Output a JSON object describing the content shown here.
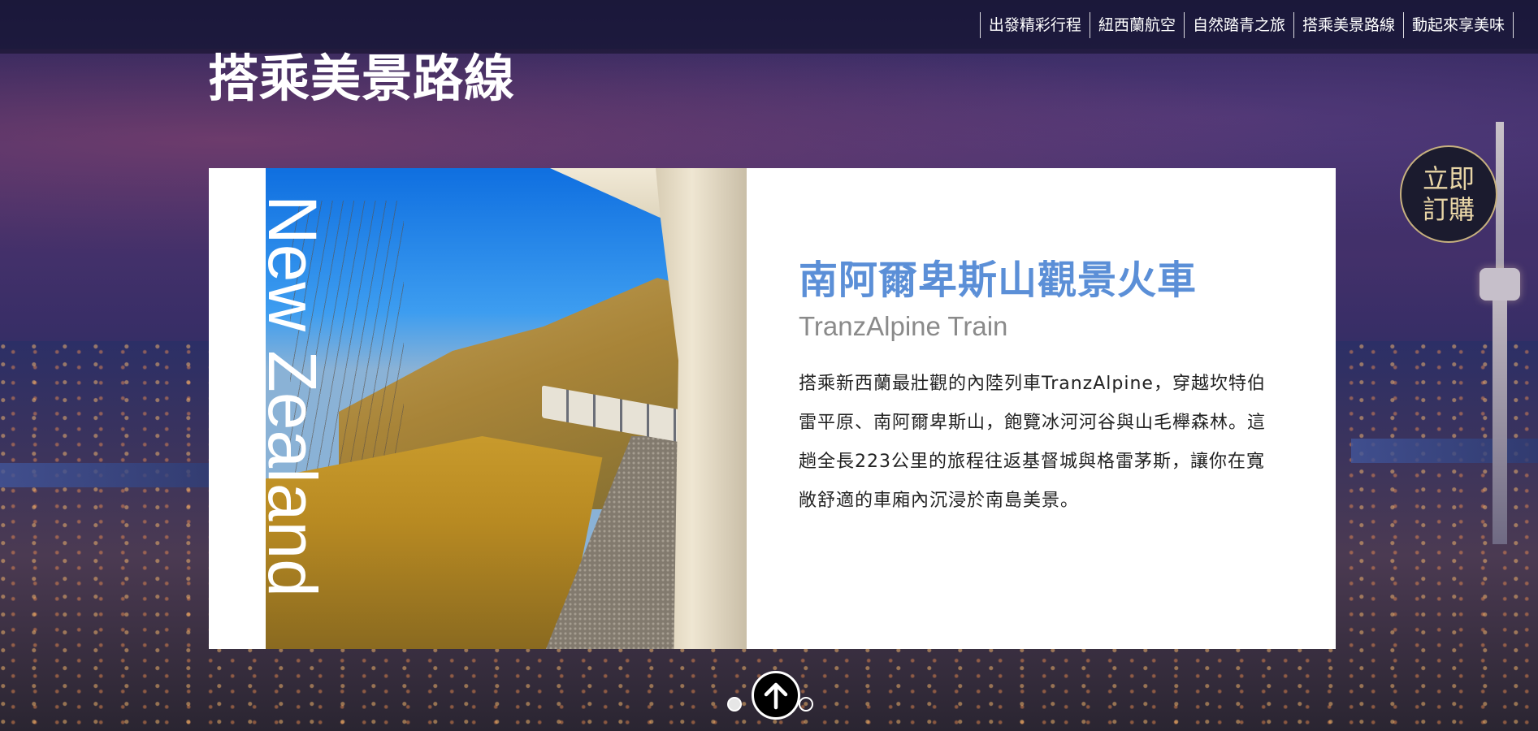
{
  "nav": {
    "items": [
      {
        "label": "出發精彩行程"
      },
      {
        "label": "紐西蘭航空"
      },
      {
        "label": "自然踏青之旅"
      },
      {
        "label": "搭乘美景路線"
      },
      {
        "label": "動起來享美味"
      }
    ]
  },
  "page": {
    "title": "搭乘美景路線"
  },
  "card": {
    "vertical_text": "New Zealand",
    "zh_title": "南阿爾卑斯山觀景火車",
    "en_title": "TranzAlpine Train",
    "description": "搭乘新西蘭最壯觀的內陸列車TranzAlpine，穿越坎特伯雷平原、南阿爾卑斯山，飽覽冰河河谷與山毛櫸森林。這趟全長223公里的旅程往返基督城與格雷茅斯，讓你在寬敞舒適的車廂內沉浸於南島美景。"
  },
  "book_button": {
    "line1": "立即",
    "line2": "訂購"
  },
  "pager": {
    "current": 1,
    "total": 2
  },
  "icons": {
    "up": "arrow-up-icon"
  }
}
